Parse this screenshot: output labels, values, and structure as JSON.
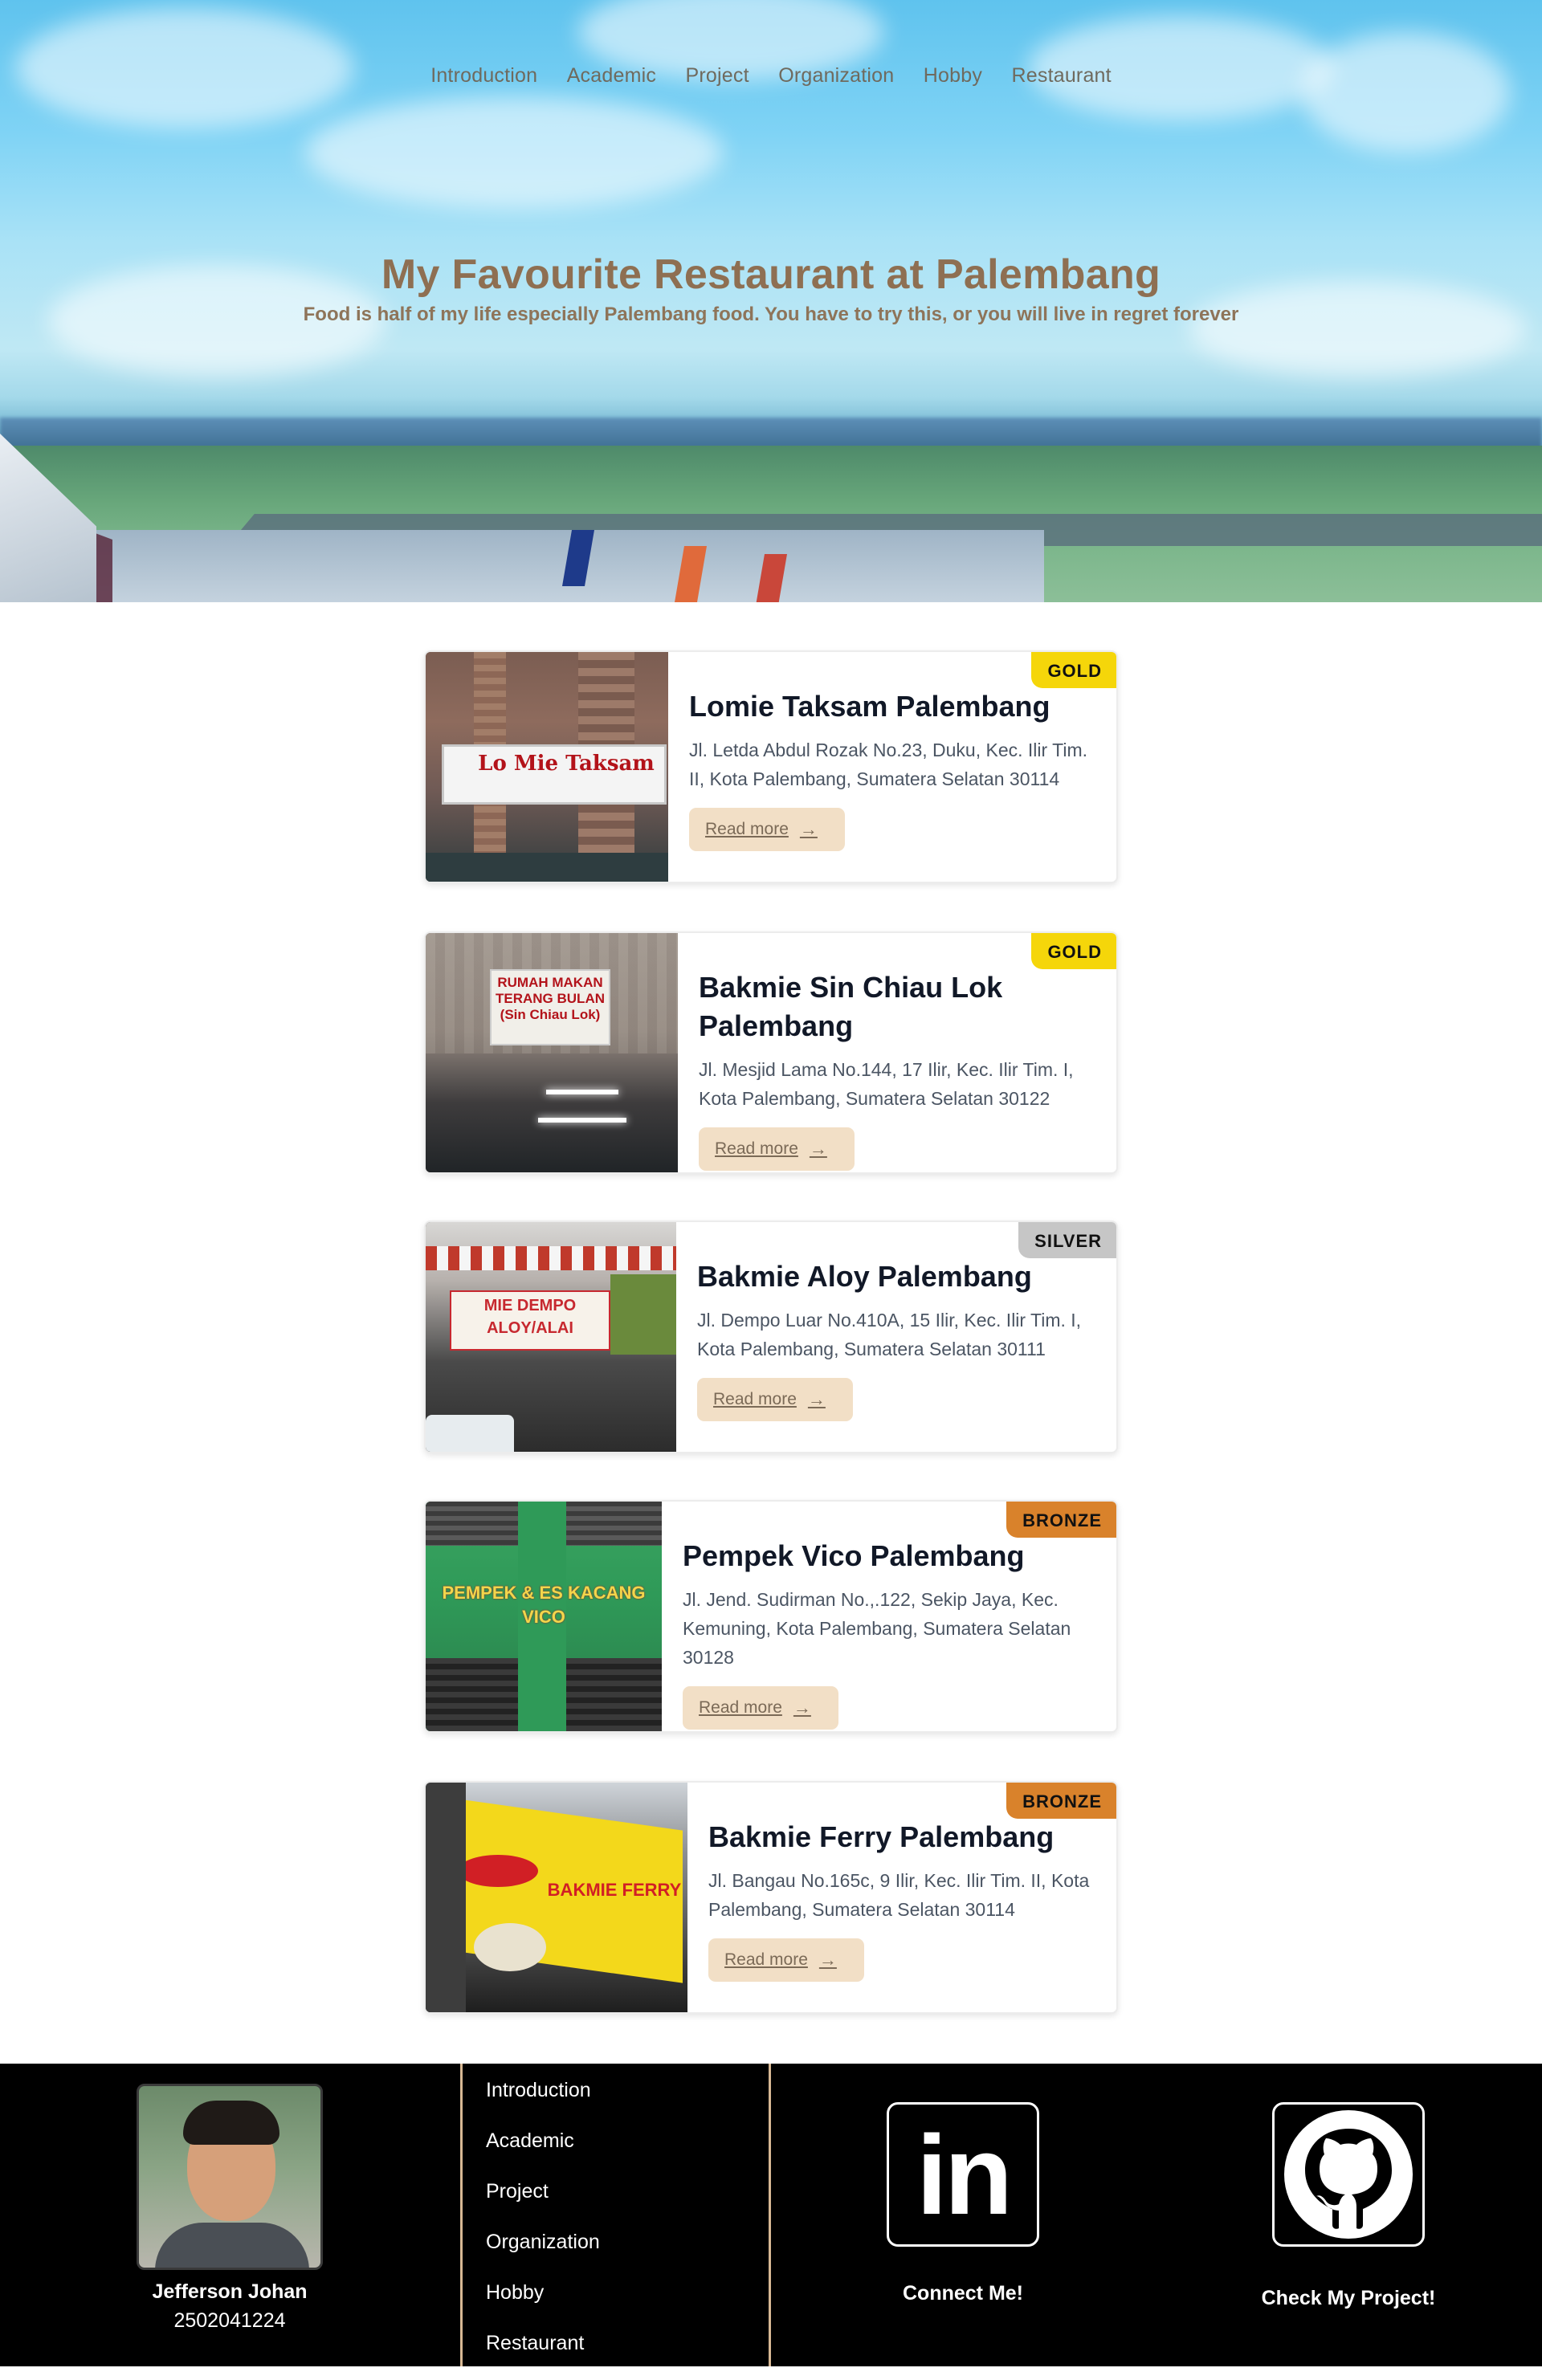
{
  "nav": {
    "items": [
      "Introduction",
      "Academic",
      "Project",
      "Organization",
      "Hobby",
      "Restaurant"
    ]
  },
  "hero": {
    "title": "My Favourite Restaurant at Palembang",
    "subtitle": "Food is half of my life especially Palembang food. You have to try this, or you will live in regret forever"
  },
  "restaurants": [
    {
      "name": "Lomie Taksam Palembang",
      "address": "Jl. Letda Abdul Rozak No.23, Duku, Kec. Ilir Tim. II, Kota Palembang, Sumatera Selatan 30114",
      "badge": "GOLD",
      "badge_color": "#f5d60a",
      "button": "Read more",
      "sign_text": "Lo Mie Taksam"
    },
    {
      "name": "Bakmie Sin Chiau Lok Palembang",
      "address": "Jl. Mesjid Lama No.144, 17 Ilir, Kec. Ilir Tim. I, Kota Palembang, Sumatera Selatan 30122",
      "badge": "GOLD",
      "badge_color": "#f5d60a",
      "button": "Read more",
      "sign_text": "RUMAH MAKAN TERANG BULAN (Sin Chiau Lok)"
    },
    {
      "name": "Bakmie Aloy Palembang",
      "address": "Jl. Dempo Luar No.410A, 15 Ilir, Kec. Ilir Tim. I, Kota Palembang, Sumatera Selatan 30111",
      "badge": "SILVER",
      "badge_color": "#c6c6c6",
      "button": "Read more",
      "sign_text": "MIE DEMPO ALOY/ALAI"
    },
    {
      "name": "Pempek Vico Palembang",
      "address": "Jl. Jend. Sudirman No.,.122, Sekip Jaya, Kec. Kemuning, Kota Palembang, Sumatera Selatan 30128",
      "badge": "BRONZE",
      "badge_color": "#d9822b",
      "button": "Read more",
      "sign_text": "PEMPEK & ES KACANG VICO"
    },
    {
      "name": "Bakmie Ferry Palembang",
      "address": "Jl. Bangau No.165c, 9 Ilir, Kec. Ilir Tim. II, Kota Palembang, Sumatera Selatan 30114",
      "badge": "BRONZE",
      "badge_color": "#d9822b",
      "button": "Read more",
      "sign_text": "BAKMIE FERRY"
    }
  ],
  "footer": {
    "name": "Jefferson Johan",
    "id": "2502041224",
    "links": [
      "Introduction",
      "Academic",
      "Project",
      "Organization",
      "Hobby",
      "Restaurant"
    ],
    "linkedin_label": "Connect Me!",
    "github_label": "Check My Project!",
    "linkedin_logo_text": "in"
  },
  "colors": {
    "accent": "#d7b894",
    "button_bg": "#f2dfc6",
    "hero_text": "#8e6f52"
  }
}
